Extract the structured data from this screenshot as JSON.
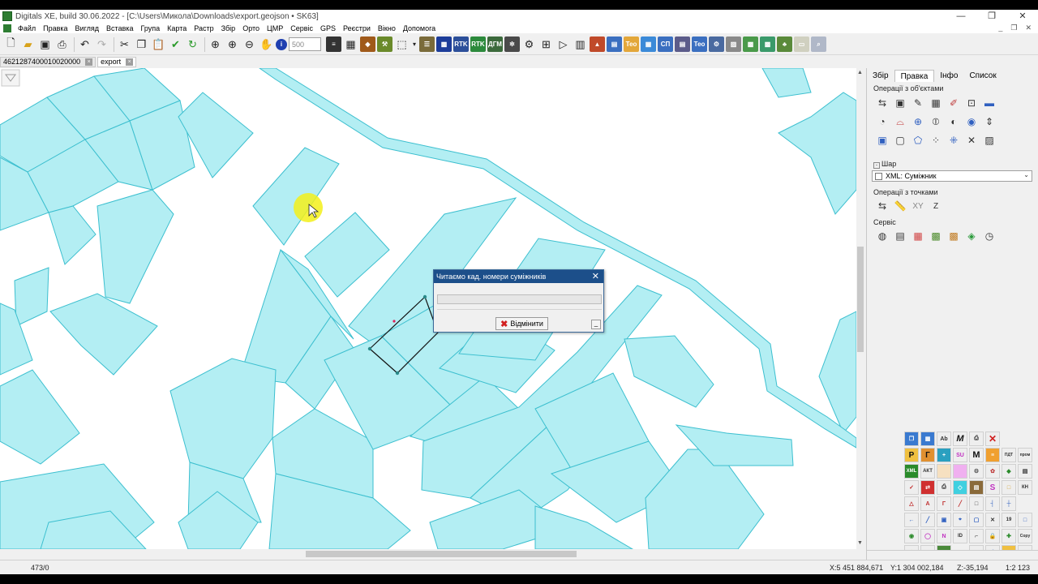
{
  "window": {
    "title": "Digitals XE, build 30.06.2022 - [C:\\Users\\Микола\\Downloads\\export.geojson • SK63]",
    "controls": [
      "—",
      "❐",
      "✕"
    ],
    "mdi_controls": [
      "_",
      "❐",
      "✕"
    ]
  },
  "menu": [
    "Файл",
    "Правка",
    "Вигляд",
    "Вставка",
    "Група",
    "Карта",
    "Растр",
    "Збір",
    "Орто",
    "ЦМР",
    "Сервіс",
    "GPS",
    "Реєстри",
    "Вікно",
    "Допомога"
  ],
  "toolbar": {
    "zoom_value": "500"
  },
  "doc_tabs": [
    {
      "label": "4621287400010020000"
    },
    {
      "label": "export"
    }
  ],
  "right_panel": {
    "tabs": [
      "Збір",
      "Правка",
      "Інфо",
      "Список"
    ],
    "active_tab": "Правка",
    "sections": {
      "objects": "Операції з об'єктами",
      "layer": "Шар",
      "points": "Операції з точками",
      "service": "Сервіс"
    },
    "layer_value": "XML: Суміжник",
    "xy_label": "XY",
    "z_label": "Z"
  },
  "dialog": {
    "title": "Читаємо кад. номери суміжників",
    "progress": 0,
    "cancel_label": "Відмінити",
    "minimize_label": "_"
  },
  "status": {
    "count": "473/0",
    "x": "X:5 451 884,671",
    "y": "Y:1 304 002,184",
    "z": "Z:-35,194",
    "scale": "1:2 123"
  },
  "colors": {
    "parcel_fill": "#b3eef3",
    "parcel_stroke": "#3cbfcf",
    "cursor_highlight": "#f3f01a",
    "dialog_title": "#1c4f8a"
  }
}
